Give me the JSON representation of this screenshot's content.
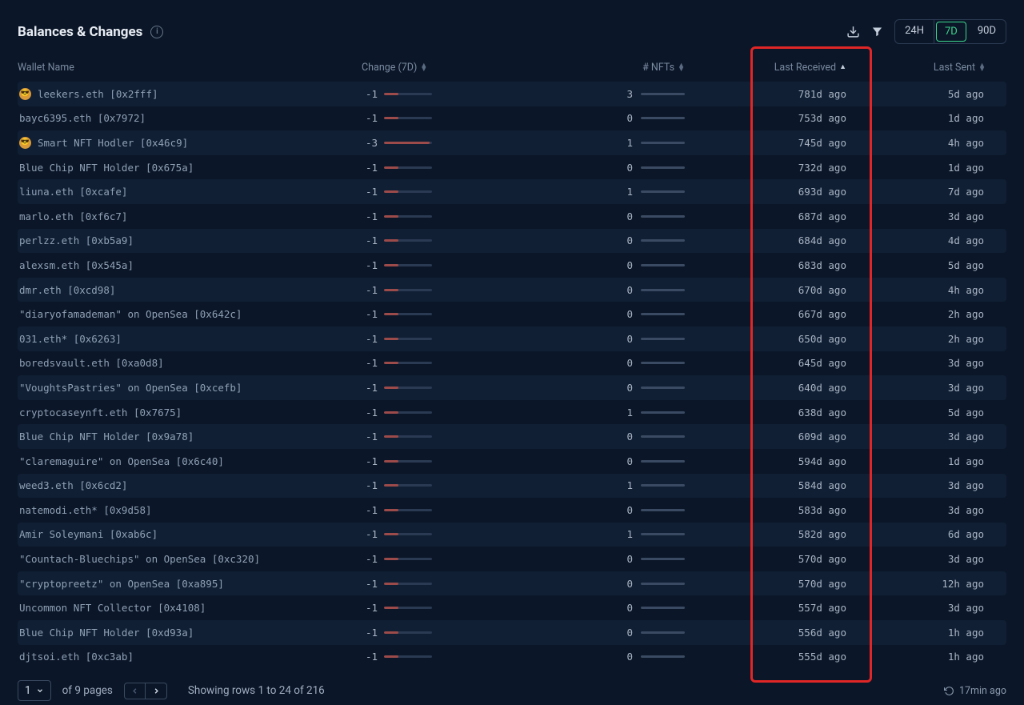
{
  "header": {
    "title": "Balances & Changes",
    "ranges": [
      "24H",
      "7D",
      "90D"
    ],
    "active_range": "7D"
  },
  "columns": {
    "wallet": "Wallet Name",
    "change": "Change (7D)",
    "nfts": "# NFTs",
    "received": "Last Received",
    "sent": "Last Sent"
  },
  "rows": [
    {
      "badge": true,
      "name": "leekers.eth [0x2fff]",
      "change": "-1",
      "bar": 30,
      "nfts": "3",
      "received": "781d ago",
      "sent": "5d ago"
    },
    {
      "badge": false,
      "name": "bayc6395.eth [0x7972]",
      "change": "-1",
      "bar": 30,
      "nfts": "0",
      "received": "753d ago",
      "sent": "1d ago"
    },
    {
      "badge": true,
      "name": "Smart NFT Hodler [0x46c9]",
      "change": "-3",
      "bar": 95,
      "nfts": "1",
      "received": "745d ago",
      "sent": "4h ago"
    },
    {
      "badge": false,
      "name": "Blue Chip NFT Holder [0x675a]",
      "change": "-1",
      "bar": 30,
      "nfts": "0",
      "received": "732d ago",
      "sent": "1d ago"
    },
    {
      "badge": false,
      "name": "liuna.eth [0xcafe]",
      "change": "-1",
      "bar": 30,
      "nfts": "1",
      "received": "693d ago",
      "sent": "7d ago"
    },
    {
      "badge": false,
      "name": "marlo.eth [0xf6c7]",
      "change": "-1",
      "bar": 30,
      "nfts": "0",
      "received": "687d ago",
      "sent": "3d ago"
    },
    {
      "badge": false,
      "name": "perlzz.eth [0xb5a9]",
      "change": "-1",
      "bar": 30,
      "nfts": "0",
      "received": "684d ago",
      "sent": "4d ago"
    },
    {
      "badge": false,
      "name": "alexsm.eth [0x545a]",
      "change": "-1",
      "bar": 30,
      "nfts": "0",
      "received": "683d ago",
      "sent": "5d ago"
    },
    {
      "badge": false,
      "name": "dmr.eth [0xcd98]",
      "change": "-1",
      "bar": 30,
      "nfts": "0",
      "received": "670d ago",
      "sent": "4h ago"
    },
    {
      "badge": false,
      "name": "\"diaryofamademan\" on OpenSea [0x642c]",
      "change": "-1",
      "bar": 30,
      "nfts": "0",
      "received": "667d ago",
      "sent": "2h ago"
    },
    {
      "badge": false,
      "name": "031.eth* [0x6263]",
      "change": "-1",
      "bar": 30,
      "nfts": "0",
      "received": "650d ago",
      "sent": "2h ago"
    },
    {
      "badge": false,
      "name": "boredsvault.eth [0xa0d8]",
      "change": "-1",
      "bar": 30,
      "nfts": "0",
      "received": "645d ago",
      "sent": "3d ago"
    },
    {
      "badge": false,
      "name": "\"VoughtsPastries\" on OpenSea [0xcefb]",
      "change": "-1",
      "bar": 30,
      "nfts": "0",
      "received": "640d ago",
      "sent": "3d ago"
    },
    {
      "badge": false,
      "name": "cryptocaseynft.eth [0x7675]",
      "change": "-1",
      "bar": 30,
      "nfts": "1",
      "received": "638d ago",
      "sent": "5d ago"
    },
    {
      "badge": false,
      "name": "Blue Chip NFT Holder [0x9a78]",
      "change": "-1",
      "bar": 30,
      "nfts": "0",
      "received": "609d ago",
      "sent": "3d ago"
    },
    {
      "badge": false,
      "name": "\"claremaguire\" on OpenSea [0x6c40]",
      "change": "-1",
      "bar": 30,
      "nfts": "0",
      "received": "594d ago",
      "sent": "1d ago"
    },
    {
      "badge": false,
      "name": "weed3.eth [0x6cd2]",
      "change": "-1",
      "bar": 30,
      "nfts": "1",
      "received": "584d ago",
      "sent": "3d ago"
    },
    {
      "badge": false,
      "name": "natemodi.eth* [0x9d58]",
      "change": "-1",
      "bar": 30,
      "nfts": "0",
      "received": "583d ago",
      "sent": "3d ago"
    },
    {
      "badge": false,
      "name": "Amir Soleymani [0xab6c]",
      "change": "-1",
      "bar": 30,
      "nfts": "1",
      "received": "582d ago",
      "sent": "6d ago"
    },
    {
      "badge": false,
      "name": "\"Countach-Bluechips\" on OpenSea [0xc320]",
      "change": "-1",
      "bar": 30,
      "nfts": "0",
      "received": "570d ago",
      "sent": "3d ago"
    },
    {
      "badge": false,
      "name": "\"cryptopreetz\" on OpenSea [0xa895]",
      "change": "-1",
      "bar": 30,
      "nfts": "0",
      "received": "570d ago",
      "sent": "12h ago"
    },
    {
      "badge": false,
      "name": "Uncommon NFT Collector [0x4108]",
      "change": "-1",
      "bar": 30,
      "nfts": "0",
      "received": "557d ago",
      "sent": "3d ago"
    },
    {
      "badge": false,
      "name": "Blue Chip NFT Holder [0xd93a]",
      "change": "-1",
      "bar": 30,
      "nfts": "0",
      "received": "556d ago",
      "sent": "1h ago"
    },
    {
      "badge": false,
      "name": "djtsoi.eth [0xc3ab]",
      "change": "-1",
      "bar": 30,
      "nfts": "0",
      "received": "555d ago",
      "sent": "1h ago"
    }
  ],
  "footer": {
    "page": "1",
    "pages_text": "of 9 pages",
    "showing": "Showing rows 1 to 24 of 216",
    "updated": "17min ago"
  }
}
